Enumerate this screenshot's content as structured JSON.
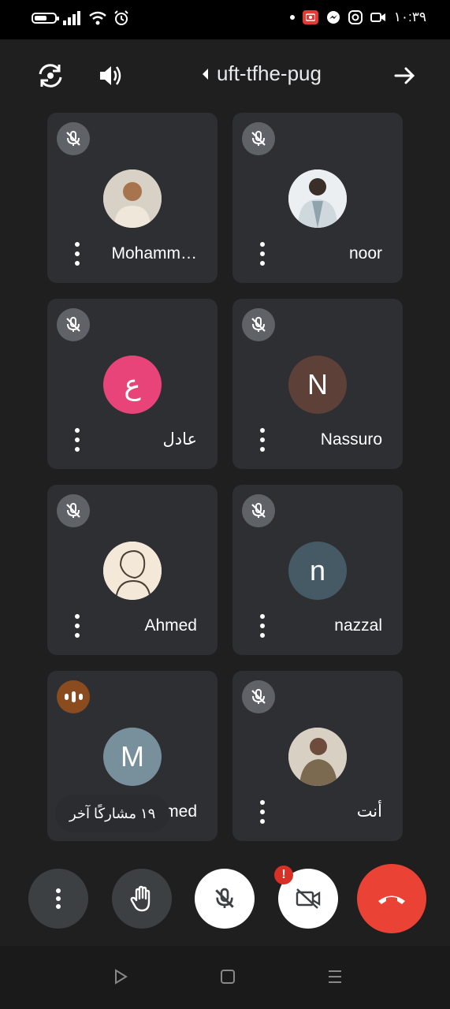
{
  "status_bar": {
    "time": "١٠:٣٩"
  },
  "meeting": {
    "code": "uft-tfhe-pug"
  },
  "participants": [
    {
      "name": "Mohamm…",
      "avatar_type": "photo",
      "mic": "muted"
    },
    {
      "name": "noor",
      "avatar_type": "photo",
      "mic": "muted"
    },
    {
      "name": "عادل",
      "initial": "ع",
      "avatar_color": "#e8447a",
      "mic": "muted"
    },
    {
      "name": "Nassuro",
      "initial": "N",
      "avatar_color": "#5d4037",
      "mic": "muted"
    },
    {
      "name": "Ahmed",
      "avatar_type": "photo",
      "mic": "muted"
    },
    {
      "name": "nazzal",
      "initial": "n",
      "avatar_color": "#455a64",
      "mic": "muted"
    },
    {
      "name": "Mahmed",
      "initial": "M",
      "avatar_color": "#78909c",
      "mic": "speaking"
    },
    {
      "name": "أنت",
      "avatar_type": "photo",
      "mic": "muted"
    }
  ],
  "toast": {
    "text": "١٩ مشاركًا آخر"
  },
  "controls": {
    "more": "more-options-icon",
    "raise_hand": "hand-icon",
    "mic": "mic-off-icon",
    "camera": "camera-off-icon",
    "camera_alert": "!",
    "end_call": "end-call-icon",
    "end_call_color": "#ea4335"
  },
  "colors": {
    "background": "#1f1f1f",
    "tile": "#2e2f33",
    "accent_red": "#ea4335"
  }
}
